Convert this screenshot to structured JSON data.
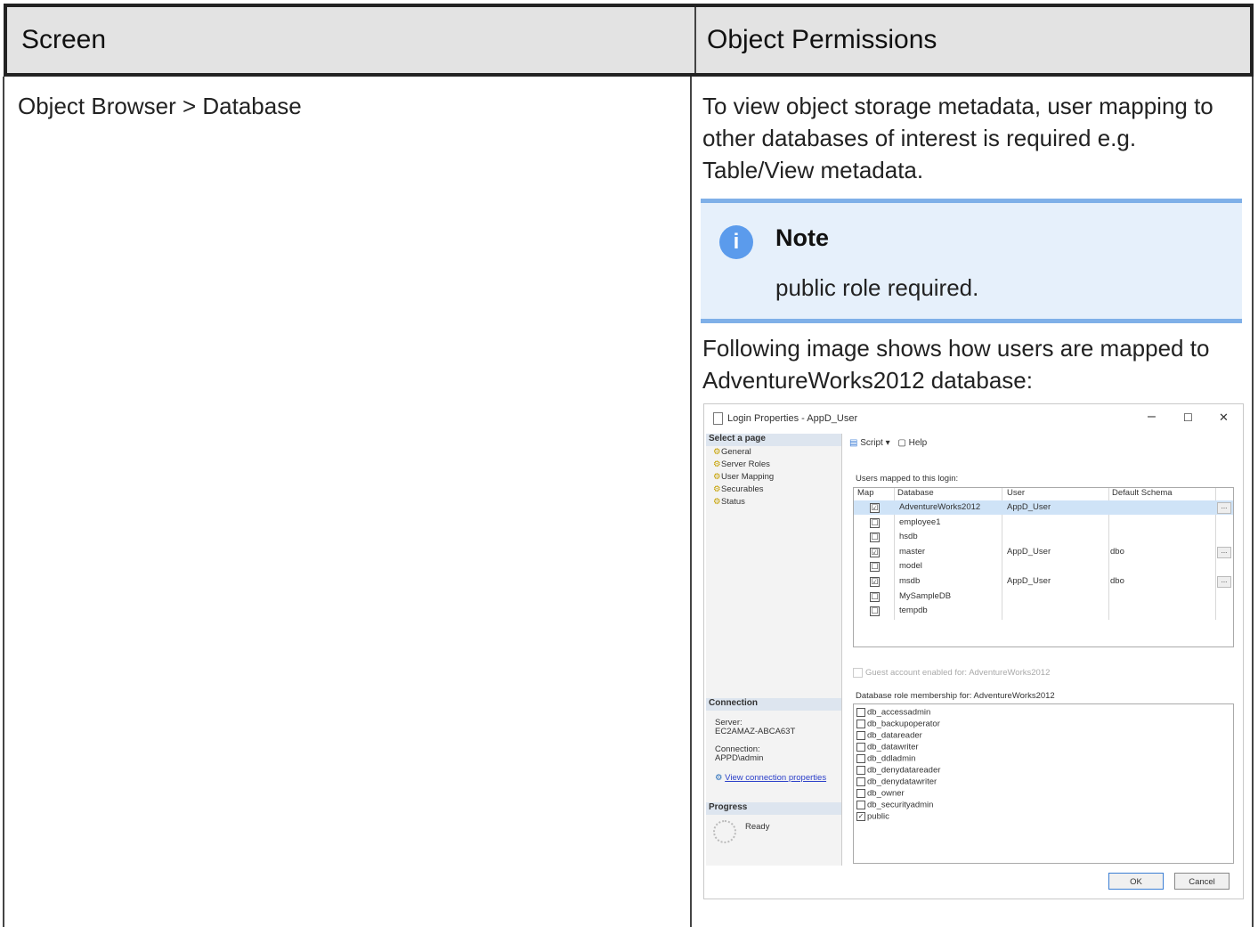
{
  "table": {
    "header": {
      "screen": "Screen",
      "permissions": "Object Permissions"
    },
    "row": {
      "screen": "Object Browser > Database",
      "text1": "To view object storage metadata, user mapping to other databases of interest is required e.g. Table/View metadata.",
      "note": {
        "title": "Note",
        "body": "public role required."
      },
      "text2": "Following image shows how users are mapped to AdventureWorks2012 database:"
    }
  },
  "dialog": {
    "title": "Login Properties - AppD_User",
    "window_controls": {
      "minimize": "–",
      "maximize": "☐",
      "close": "✕"
    },
    "select_page": "Select a page",
    "pages": [
      "General",
      "Server Roles",
      "User Mapping",
      "Securables",
      "Status"
    ],
    "connection": {
      "heading": "Connection",
      "server_label": "Server:",
      "server": "EC2AMAZ-ABCA63T",
      "connection_label": "Connection:",
      "connection": "APPD\\admin",
      "link": "View connection properties"
    },
    "progress": {
      "heading": "Progress",
      "status": "Ready"
    },
    "toolbar": {
      "script": "Script",
      "help": "Help"
    },
    "users_mapped_label": "Users mapped to this login:",
    "columns": [
      "Map",
      "Database",
      "User",
      "Default Schema"
    ],
    "rows": [
      {
        "checked": "☑",
        "db": "AdventureWorks2012",
        "user": "AppD_User",
        "schema": "",
        "btn": "..."
      },
      {
        "checked": "☐",
        "db": "employee1",
        "user": "",
        "schema": "",
        "btn": ""
      },
      {
        "checked": "☐",
        "db": "hsdb",
        "user": "",
        "schema": "",
        "btn": ""
      },
      {
        "checked": "☑",
        "db": "master",
        "user": "AppD_User",
        "schema": "dbo",
        "btn": "..."
      },
      {
        "checked": "☐",
        "db": "model",
        "user": "",
        "schema": "",
        "btn": ""
      },
      {
        "checked": "☑",
        "db": "msdb",
        "user": "AppD_User",
        "schema": "dbo",
        "btn": "..."
      },
      {
        "checked": "☐",
        "db": "MySampleDB",
        "user": "",
        "schema": "",
        "btn": ""
      },
      {
        "checked": "☐",
        "db": "tempdb",
        "user": "",
        "schema": "",
        "btn": ""
      }
    ],
    "guest": "Guest account enabled for: AdventureWorks2012",
    "role_label": "Database role membership for: AdventureWorks2012",
    "roles": [
      {
        "checked": "",
        "name": "db_accessadmin"
      },
      {
        "checked": "",
        "name": "db_backupoperator"
      },
      {
        "checked": "",
        "name": "db_datareader"
      },
      {
        "checked": "",
        "name": "db_datawriter"
      },
      {
        "checked": "",
        "name": "db_ddladmin"
      },
      {
        "checked": "",
        "name": "db_denydatareader"
      },
      {
        "checked": "",
        "name": "db_denydatawriter"
      },
      {
        "checked": "",
        "name": "db_owner"
      },
      {
        "checked": "",
        "name": "db_securityadmin"
      },
      {
        "checked": "✓",
        "name": "public"
      }
    ],
    "buttons": {
      "ok": "OK",
      "cancel": "Cancel"
    }
  }
}
